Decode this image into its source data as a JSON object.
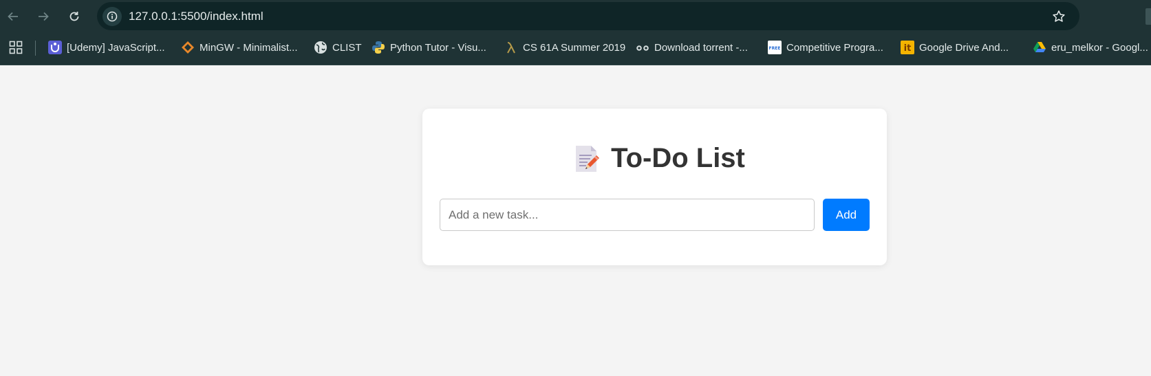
{
  "browser": {
    "url": "127.0.0.1:5500/index.html",
    "icons": {
      "back": "arrow-left-icon",
      "forward": "arrow-right-icon",
      "reload": "reload-icon",
      "site_info": "info-icon",
      "bookmark": "star-icon",
      "apps": "apps-grid-icon"
    },
    "bookmarks": [
      {
        "label": "[Udemy] JavaScript...",
        "icon": "udemy-icon"
      },
      {
        "label": "MinGW - Minimalist...",
        "icon": "mingw-icon"
      },
      {
        "label": "CLIST",
        "icon": "globe-icon"
      },
      {
        "label": "Python Tutor - Visu...",
        "icon": "python-icon"
      },
      {
        "label": "CS 61A Summer 2019",
        "icon": "lambda-icon"
      },
      {
        "label": "Download torrent -...",
        "icon": "glasses-icon"
      },
      {
        "label": "Competitive Progra...",
        "icon": "free-badge-icon"
      },
      {
        "label": "Google Drive And...",
        "icon": "it-icon"
      },
      {
        "label": "eru_melkor - Googl...",
        "icon": "google-drive-icon"
      }
    ]
  },
  "app": {
    "title_icon": "memo-icon",
    "title": "To-Do List",
    "input_placeholder": "Add a new task...",
    "input_value": "",
    "add_label": "Add",
    "accent_color": "#007bff"
  }
}
